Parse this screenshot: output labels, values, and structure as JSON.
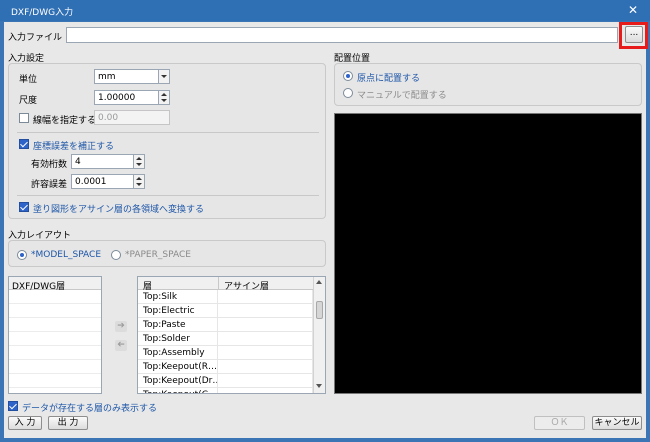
{
  "window": {
    "title": "DXF/DWG入力",
    "close_glyph": "✕"
  },
  "input_file": {
    "label": "入力ファイル",
    "value": "",
    "browse_label": "..."
  },
  "input_settings": {
    "section_label": "入力設定",
    "unit": {
      "label": "単位",
      "value": "mm"
    },
    "scale": {
      "label": "尺度",
      "value": "1.00000"
    },
    "line_width": {
      "label": "線幅を指定する",
      "value": "0.00",
      "checked": false
    },
    "correct_error": {
      "label": "座標誤差を補正する",
      "checked": true
    },
    "significant_digits": {
      "label": "有効桁数",
      "value": "4"
    },
    "tolerance": {
      "label": "許容誤差",
      "value": "0.0001"
    },
    "convert_fill": {
      "label": "塗り図形をアサイン層の各領域へ変換する",
      "checked": true
    }
  },
  "layout": {
    "section_label": "入力レイアウト",
    "options": [
      {
        "label": "*MODEL_SPACE",
        "selected": true
      },
      {
        "label": "*PAPER_SPACE",
        "selected": false
      }
    ]
  },
  "dxf_layers": {
    "header": "DXF/DWG層",
    "items": []
  },
  "mapping": {
    "headers": [
      "層",
      "アサイン層"
    ],
    "rows": [
      {
        "layer": "Top:Silk",
        "assign": ""
      },
      {
        "layer": "Top:Electric",
        "assign": ""
      },
      {
        "layer": "Top:Paste",
        "assign": ""
      },
      {
        "layer": "Top:Solder",
        "assign": ""
      },
      {
        "layer": "Top:Assembly",
        "assign": ""
      },
      {
        "layer": "Top:Keepout(R…",
        "assign": ""
      },
      {
        "layer": "Top:Keepout(Dr…",
        "assign": ""
      },
      {
        "layer": "Top:Keepout(C…",
        "assign": ""
      }
    ]
  },
  "show_existing": {
    "label": "データが存在する層のみ表示する",
    "checked": true
  },
  "placement": {
    "section_label": "配置位置",
    "options": [
      {
        "label": "原点に配置する",
        "selected": true
      },
      {
        "label": "マニュアルで配置する",
        "selected": false
      }
    ]
  },
  "buttons": {
    "input": "入 力",
    "output": "出 力",
    "ok": "ＯＫ",
    "cancel": "キャンセル"
  },
  "colors": {
    "titlebar": "#2f6fb4",
    "accent": "#2e63c9",
    "highlight": "#e81b1b",
    "preview": "#000000"
  }
}
